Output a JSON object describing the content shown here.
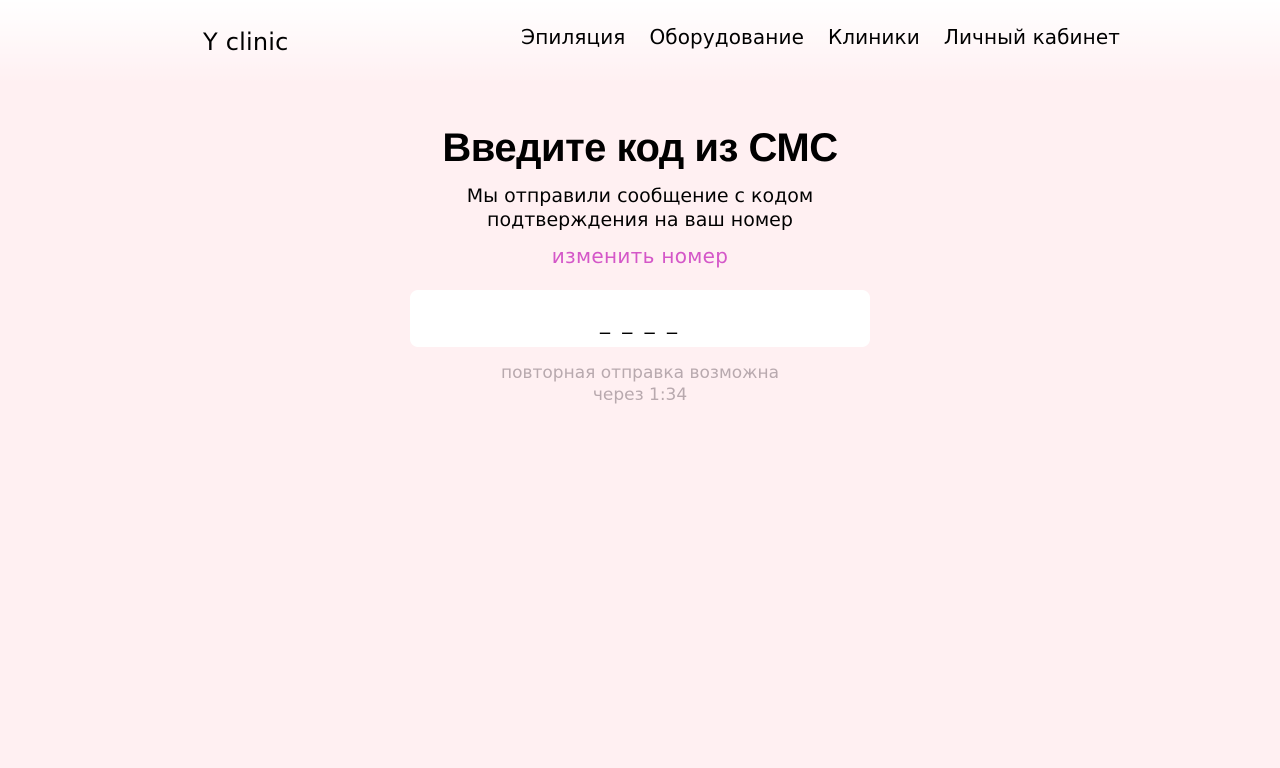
{
  "header": {
    "logo": "Y clinic",
    "nav": [
      "Эпиляция",
      "Оборудование",
      "Клиники",
      "Личный кабинет"
    ]
  },
  "main": {
    "title": "Введите код из СМС",
    "subtitle_line1": "Мы отправили сообщение с кодом",
    "subtitle_line2": "подтверждения на ваш номер",
    "change_number": "изменить номер",
    "code_placeholder": "_ _ _ _",
    "resend_line1": "повторная отправка возможна",
    "resend_line2": "через 1:34"
  },
  "colors": {
    "background": "#fff0f2",
    "accent": "#d457c8",
    "muted": "#b8a9ae"
  }
}
